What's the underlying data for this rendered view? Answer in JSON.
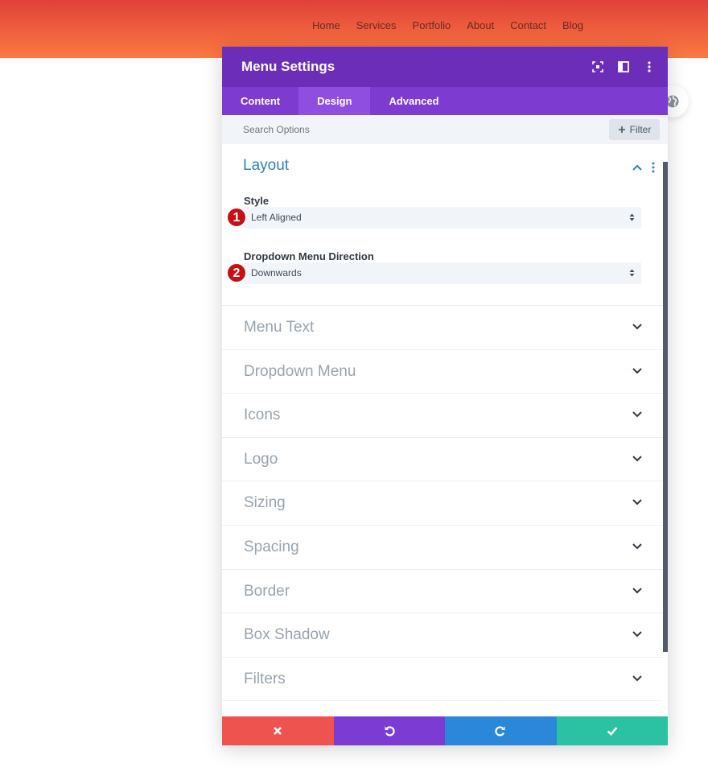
{
  "site_nav": [
    "Home",
    "Services",
    "Portfolio",
    "About",
    "Contact",
    "Blog"
  ],
  "panel": {
    "title": "Menu Settings",
    "tabs": [
      {
        "label": "Content",
        "active": false
      },
      {
        "label": "Design",
        "active": true
      },
      {
        "label": "Advanced",
        "active": false
      }
    ],
    "search_placeholder": "Search Options",
    "filter_label": "Filter"
  },
  "layout_section": {
    "title": "Layout",
    "style_label": "Style",
    "style_value": "Left Aligned",
    "style_badge": "1",
    "direction_label": "Dropdown Menu Direction",
    "direction_value": "Downwards",
    "direction_badge": "2"
  },
  "sections": [
    "Menu Text",
    "Dropdown Menu",
    "Icons",
    "Logo",
    "Sizing",
    "Spacing",
    "Border",
    "Box Shadow",
    "Filters"
  ],
  "colors": {
    "header_purple": "#6c2eb9",
    "tabs_purple": "#7e3bd0",
    "accent_blue": "#2c83b8",
    "cancel": "#ef5350",
    "undo": "#7c3bd3",
    "redo": "#2b87da",
    "save": "#2bc1a3",
    "badge_red": "#c70f16"
  },
  "icons": {
    "head": [
      "focus-icon",
      "split-view-icon",
      "more-vertical-icon"
    ],
    "footer": [
      "close-icon",
      "undo-icon",
      "redo-icon",
      "check-icon"
    ]
  }
}
